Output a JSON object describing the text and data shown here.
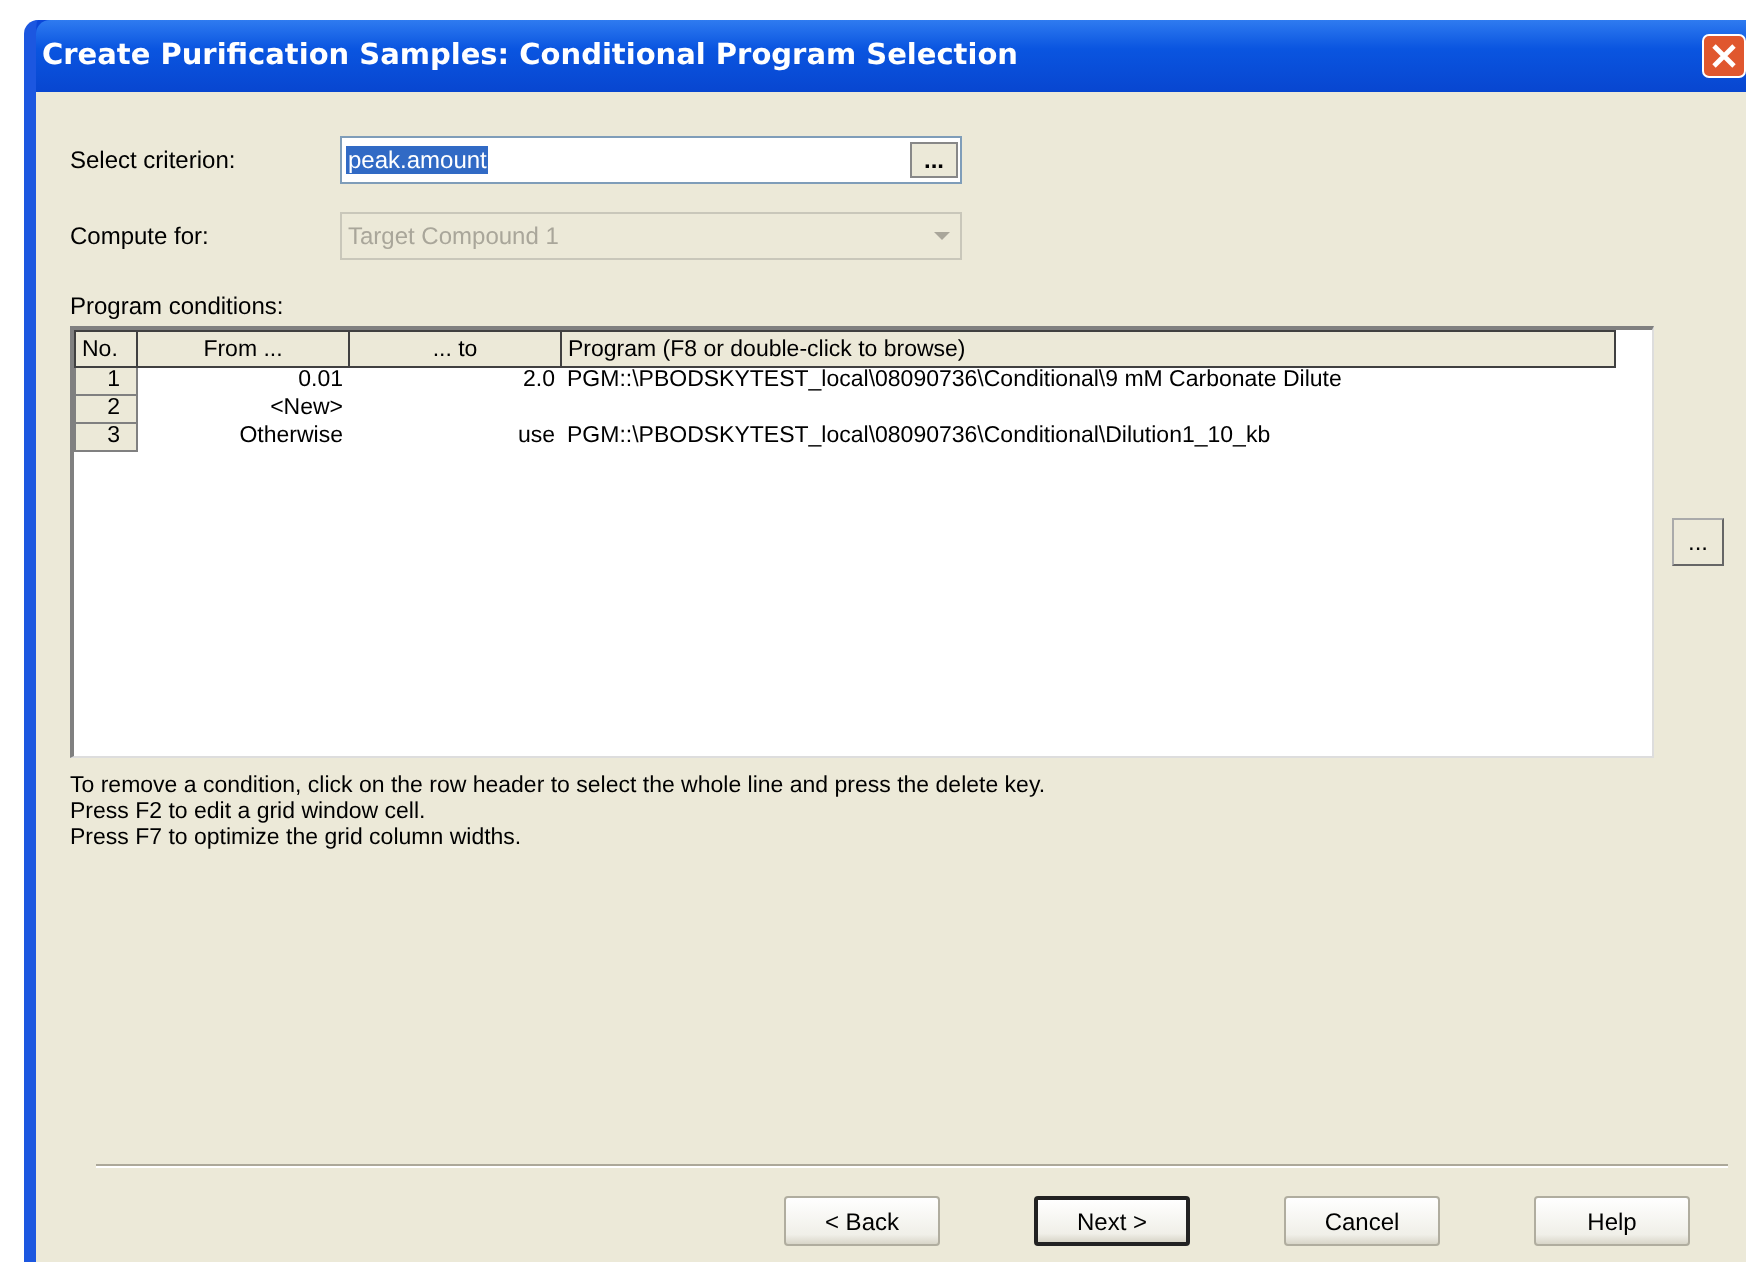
{
  "window": {
    "title": "Create Purification Samples: Conditional Program Selection"
  },
  "criterion": {
    "label": "Select criterion:",
    "value": "peak.amount",
    "value_selected": true,
    "browse": "..."
  },
  "compute_for": {
    "label": "Compute for:",
    "value": "Target Compound 1",
    "disabled": true
  },
  "conditions": {
    "label": "Program conditions:",
    "columns": [
      "No.",
      "From ...",
      "... to",
      "Program (F8 or double-click to browse)"
    ],
    "rows": [
      {
        "no": "1",
        "from": "0.01",
        "to": "2.0",
        "program": "PGM::\\PBODSKYTEST_local\\08090736\\Conditional\\9 mM Carbonate Dilute"
      },
      {
        "no": "2",
        "from": "<New>",
        "to": "",
        "program": ""
      },
      {
        "no": "3",
        "from": "Otherwise",
        "to": "use",
        "program": "PGM::\\PBODSKYTEST_local\\08090736\\Conditional\\Dilution1_10_kb"
      }
    ],
    "browse": "..."
  },
  "help_lines": [
    "To remove a condition, click on the row header to select the whole line and press the delete key.",
    "Press F2 to edit a grid window cell.",
    "Press F7 to optimize the grid column widths."
  ],
  "buttons": [
    {
      "label": "< Back",
      "default": false
    },
    {
      "label": "Next >",
      "default": true
    },
    {
      "label": "Cancel",
      "default": false
    },
    {
      "label": "Help",
      "default": false
    }
  ]
}
